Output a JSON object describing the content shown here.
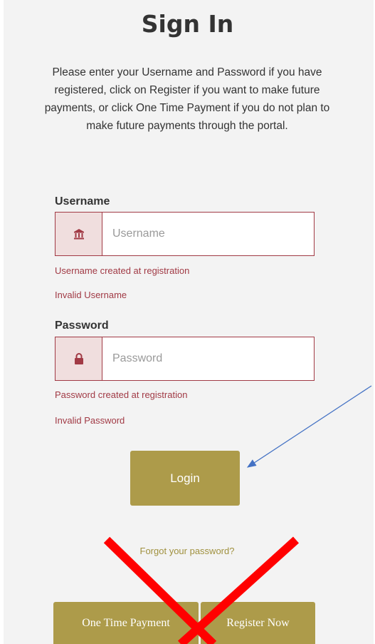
{
  "title": "Sign In",
  "intro": "Please enter your Username and Password if you have registered, click on Register if you want to make future payments, or click One Time Payment if you do not plan to make future payments through the portal.",
  "username": {
    "label": "Username",
    "placeholder": "Username",
    "value": "",
    "icon": "bank-icon",
    "help": "Username created at registration",
    "error": "Invalid Username"
  },
  "password": {
    "label": "Password",
    "placeholder": "Password",
    "value": "",
    "icon": "lock-icon",
    "help": "Password created at registration",
    "error": "Invalid Password"
  },
  "login_label": "Login",
  "forgot_label": "Forgot your password?",
  "one_time_payment_label": "One Time Payment",
  "register_label": "Register Now",
  "colors": {
    "accent": "#ad9b4a",
    "error": "#a13a45",
    "annotation_arrow": "#4472c4",
    "annotation_cross": "#ff0000"
  }
}
